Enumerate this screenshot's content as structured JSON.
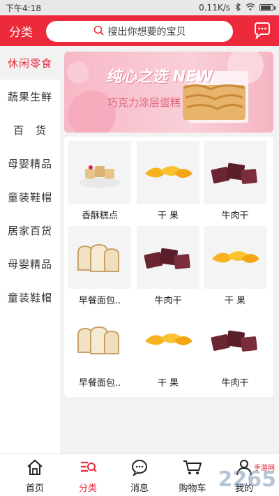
{
  "status": {
    "time": "下午4:18",
    "speed": "0.11K/s",
    "battery_level": 0.8
  },
  "header": {
    "title": "分类",
    "search_placeholder": "搜出你想要的宝贝",
    "message_icon": "chat-bubble-icon"
  },
  "sidebar": {
    "items": [
      {
        "label": "休闲零食",
        "active": true
      },
      {
        "label": "蔬果生鲜"
      },
      {
        "label": "百　货"
      },
      {
        "label": "母婴精品"
      },
      {
        "label": "童装鞋帽"
      },
      {
        "label": "居家百货"
      },
      {
        "label": "母婴精品"
      },
      {
        "label": "童装鞋帽"
      }
    ]
  },
  "banner": {
    "script": "纯心之选 NEW",
    "title": "巧克力涂层蛋糕"
  },
  "products": [
    {
      "label": "香酥糕点",
      "icon": "pastry"
    },
    {
      "label": "干 果",
      "icon": "mango"
    },
    {
      "label": "牛肉干",
      "icon": "jerky"
    },
    {
      "label": "早餐面包..",
      "icon": "bread"
    },
    {
      "label": "牛肉干",
      "icon": "jerky"
    },
    {
      "label": "干 果",
      "icon": "mango"
    },
    {
      "label": "早餐面包..",
      "icon": "bread"
    },
    {
      "label": "干 果",
      "icon": "mango"
    },
    {
      "label": "牛肉干",
      "icon": "jerky"
    }
  ],
  "tabbar": {
    "items": [
      {
        "label": "首页",
        "icon": "home-icon"
      },
      {
        "label": "分类",
        "icon": "category-icon",
        "active": true
      },
      {
        "label": "消息",
        "icon": "message-icon"
      },
      {
        "label": "购物车",
        "icon": "cart-icon"
      },
      {
        "label": "我的",
        "icon": "profile-icon"
      }
    ]
  },
  "watermark": {
    "brand": "2265",
    "site": "手游网"
  },
  "colors": {
    "accent": "#ec2a3b"
  }
}
